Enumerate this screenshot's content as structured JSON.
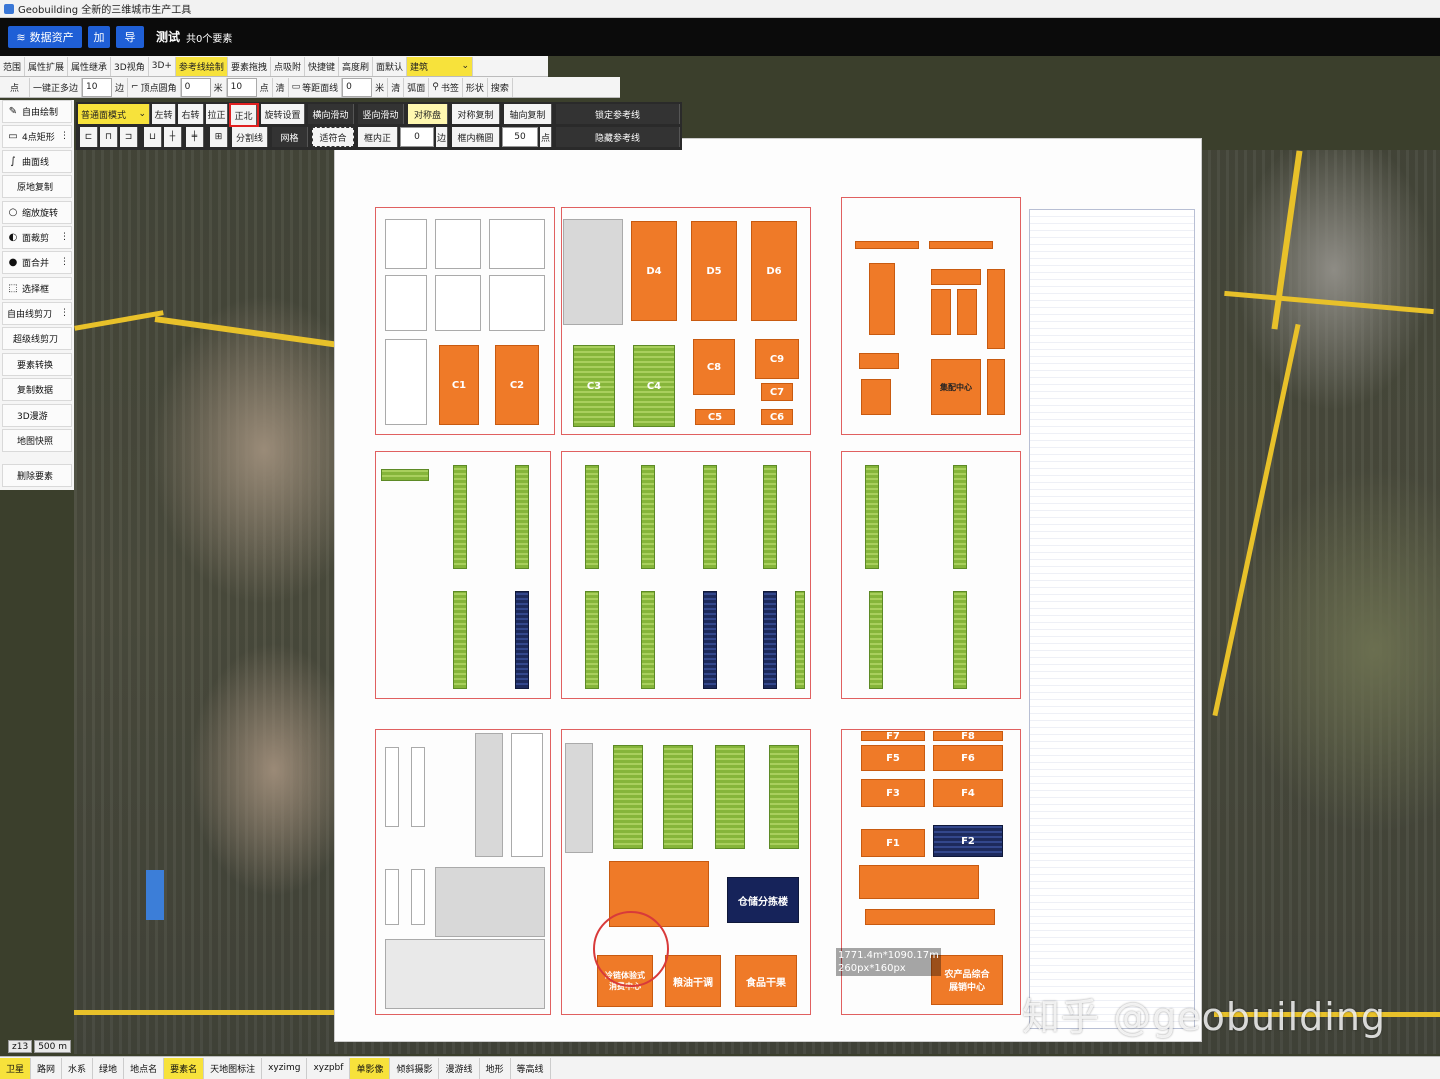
{
  "window": {
    "title": "Geobuilding 全新的三维城市生产工具"
  },
  "header": {
    "dataset_button": "数据资产",
    "add_button": "加",
    "export_button": "导",
    "layer_name": "测试",
    "layer_count": "共0个要素"
  },
  "toolbar1": [
    "范围",
    "属性扩展",
    "属性继承",
    "3D视角",
    "3D+",
    "参考线绘制",
    "要素拖拽",
    "点吸附",
    "快捷键",
    "高度刷",
    "面默认",
    "建筑",
    "",
    "",
    "",
    ""
  ],
  "toolbar1_select": "建筑",
  "toolbar2": {
    "point": "点",
    "auto_side": "一键正多边",
    "sides_value": "10",
    "sides_unit": "边",
    "round_corner": "顶点圆角",
    "corner_value": "0",
    "corner_unit": "米",
    "count_value": "10",
    "count_unit": "点",
    "clear1": "清",
    "equidistant": "等距面线",
    "eq_value": "0",
    "eq_unit": "米",
    "clear2": "清",
    "arc_face": "弧面",
    "bookmark": "书签",
    "shape": "形状",
    "search": "搜索"
  },
  "leftpanel": [
    "自由绘制",
    "4点矩形",
    "曲面线",
    "原地复制",
    "缩放旋转",
    "面裁剪",
    "面合并",
    "选择框",
    "自由线剪刀",
    "超级线剪刀",
    "要素转换",
    "复制数据",
    "3D漫游",
    "地图快照",
    "删除要素"
  ],
  "drawtoolbar": {
    "mode": "普通面模式",
    "rotate_left": "左转",
    "rotate_right": "右转",
    "straighten": "拉正",
    "north": "正北",
    "rotate_settings": "旋转设置",
    "horizontal_slide": "横向滑动",
    "vertical_slide": "竖向滑动",
    "symmetry": "对称盘",
    "symmetry_copy": "对称复制",
    "axial_copy": "轴向复制",
    "lock_reference": "锁定参考线",
    "hide_reference": "隐藏参考线",
    "split_line": "分割线",
    "grid": "网格",
    "fit": "适符合",
    "inner_straighten": "框内正",
    "inner_value": "0",
    "inner_unit": "边",
    "inner_ellipse": "框内椭圆",
    "ellipse_value": "50",
    "ellipse_unit": "点"
  },
  "plan": {
    "buildings": [
      "D4",
      "D5",
      "D6",
      "C1",
      "C2",
      "C3",
      "C4",
      "C8",
      "C9",
      "C7",
      "C5",
      "C6",
      "F7",
      "F8",
      "F5",
      "F6",
      "F3",
      "F4",
      "F1",
      "F2"
    ],
    "labels": {
      "center": "集配中心",
      "warehouse": "仓储分拣楼",
      "oil": "粮油干调",
      "food": "食品干果",
      "ag_center": "农产品综合\n展销中心",
      "logistics": "冷链体验式\n消费中心"
    }
  },
  "measure": {
    "size": "1771.4m*1090.17m",
    "px": "260px*160px"
  },
  "watermark": "知乎 @geobuilding",
  "scale": {
    "zoom": "z13",
    "distance": "500 m"
  },
  "bottombar": [
    "卫星",
    "路网",
    "水系",
    "绿地",
    "地点名",
    "要素名",
    "天地图标注",
    "xyzimg",
    "xyzpbf",
    "单影像",
    "倾斜摄影",
    "漫游线",
    "地形",
    "等高线"
  ],
  "colors": {
    "accent": "#1f5fd6",
    "highlight": "#f7e23b",
    "building": "#ef7a28",
    "green": "#86b53a",
    "navy": "#1d2a5c"
  }
}
